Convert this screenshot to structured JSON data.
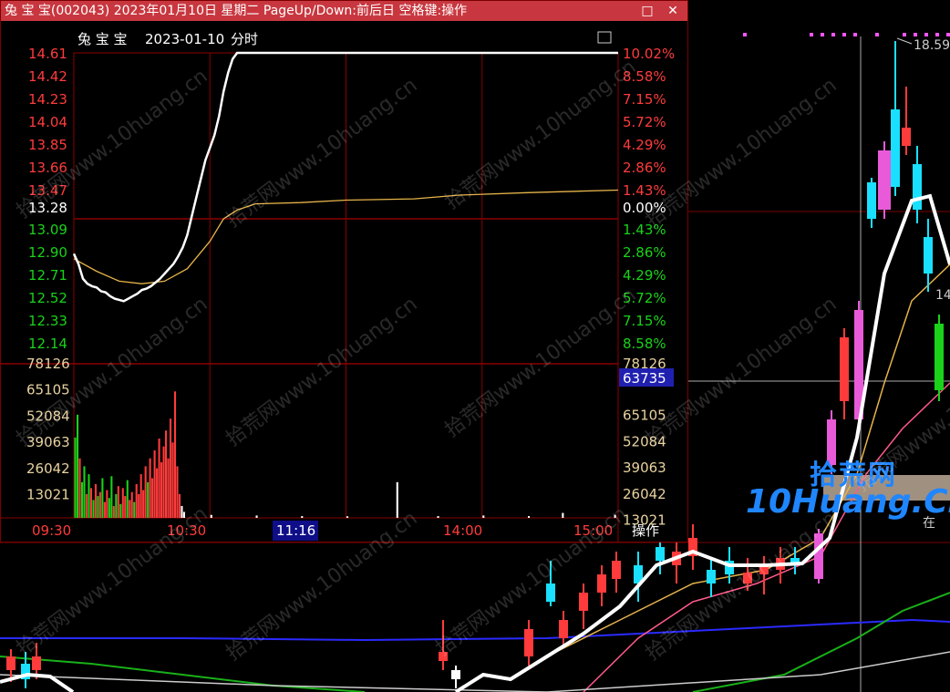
{
  "window": {
    "title": "兔 宝 宝(002043) 2023年01月10日 星期二 PageUp/Down:前后日 空格键:操作",
    "restore_icon": "restore-icon",
    "close_icon": "close-icon"
  },
  "header": {
    "stock_name": "兔 宝 宝",
    "date": "2023-01-10",
    "mode": "分时",
    "corner_icon": "expand-icon"
  },
  "colors": {
    "up": "#ff3b3b",
    "down": "#19d219",
    "neutral": "#ffffff",
    "price_line": "#ffffff",
    "avg_line": "#e6b34a",
    "grid": "#8a0000",
    "cursor_box": "#1010a0",
    "cursor_label": "#2020b0",
    "volume_axis": "#e8d2a0"
  },
  "chart_data": {
    "type": "line",
    "prev_close": 13.28,
    "price_axis": {
      "left_up": [
        "14.61",
        "14.42",
        "14.23",
        "14.04",
        "13.85",
        "13.66",
        "13.47"
      ],
      "left_center": "13.28",
      "left_down": [
        "13.09",
        "12.90",
        "12.71",
        "12.52",
        "12.33",
        "12.14"
      ],
      "right_up": [
        "10.02%",
        "8.58%",
        "7.15%",
        "5.72%",
        "4.29%",
        "2.86%",
        "1.43%"
      ],
      "right_center": "0.00%",
      "right_down": [
        "1.43%",
        "2.86%",
        "4.29%",
        "5.72%",
        "7.15%",
        "8.58%"
      ],
      "ylim": [
        12.14,
        14.61
      ]
    },
    "volume_axis": {
      "labels": [
        "78126",
        "65105",
        "52084",
        "39063",
        "26042",
        "13021"
      ],
      "ylim": [
        0,
        78126
      ],
      "cursor_value": "63735"
    },
    "time_axis": {
      "labels": [
        "09:30",
        "10:30",
        "11:16",
        "14:00",
        "15:00"
      ],
      "cursor_time": "11:16",
      "button_label": "操作"
    },
    "price_series": {
      "name": "",
      "points": [
        [
          0,
          13.0
        ],
        [
          2,
          12.92
        ],
        [
          4,
          12.8
        ],
        [
          6,
          12.76
        ],
        [
          8,
          12.74
        ],
        [
          10,
          12.73
        ],
        [
          12,
          12.7
        ],
        [
          14,
          12.69
        ],
        [
          16,
          12.66
        ],
        [
          18,
          12.64
        ],
        [
          20,
          12.63
        ],
        [
          22,
          12.62
        ],
        [
          24,
          12.64
        ],
        [
          26,
          12.66
        ],
        [
          28,
          12.68
        ],
        [
          30,
          12.71
        ],
        [
          32,
          12.72
        ],
        [
          34,
          12.74
        ],
        [
          36,
          12.77
        ],
        [
          38,
          12.8
        ],
        [
          40,
          12.84
        ],
        [
          42,
          12.88
        ],
        [
          44,
          12.92
        ],
        [
          46,
          12.98
        ],
        [
          48,
          13.05
        ],
        [
          50,
          13.15
        ],
        [
          52,
          13.3
        ],
        [
          54,
          13.45
        ],
        [
          56,
          13.6
        ],
        [
          58,
          13.75
        ],
        [
          60,
          13.85
        ],
        [
          62,
          13.95
        ],
        [
          64,
          14.1
        ],
        [
          66,
          14.3
        ],
        [
          68,
          14.45
        ],
        [
          70,
          14.56
        ],
        [
          72,
          14.61
        ],
        [
          240,
          14.61
        ]
      ]
    },
    "avg_series": {
      "name": "",
      "points": [
        [
          0,
          12.96
        ],
        [
          10,
          12.86
        ],
        [
          20,
          12.78
        ],
        [
          30,
          12.76
        ],
        [
          40,
          12.78
        ],
        [
          50,
          12.88
        ],
        [
          60,
          13.1
        ],
        [
          66,
          13.28
        ],
        [
          72,
          13.35
        ],
        [
          80,
          13.4
        ],
        [
          100,
          13.41
        ],
        [
          120,
          13.43
        ],
        [
          150,
          13.44
        ],
        [
          170,
          13.47
        ],
        [
          200,
          13.49
        ],
        [
          240,
          13.51
        ]
      ]
    },
    "volume_bars": [
      [
        0,
        40500,
        "down"
      ],
      [
        1,
        52000,
        "down"
      ],
      [
        2,
        30000,
        "up"
      ],
      [
        3,
        18000,
        "down"
      ],
      [
        4,
        26000,
        "down"
      ],
      [
        5,
        12000,
        "up"
      ],
      [
        6,
        22000,
        "down"
      ],
      [
        7,
        15000,
        "up"
      ],
      [
        8,
        9000,
        "down"
      ],
      [
        9,
        17000,
        "up"
      ],
      [
        10,
        11000,
        "down"
      ],
      [
        11,
        13000,
        "up"
      ],
      [
        12,
        20000,
        "down"
      ],
      [
        13,
        8000,
        "up"
      ],
      [
        14,
        14000,
        "up"
      ],
      [
        15,
        10000,
        "down"
      ],
      [
        16,
        21000,
        "down"
      ],
      [
        17,
        6000,
        "up"
      ],
      [
        18,
        12000,
        "down"
      ],
      [
        19,
        16000,
        "up"
      ],
      [
        20,
        7000,
        "down"
      ],
      [
        21,
        15000,
        "up"
      ],
      [
        22,
        11000,
        "up"
      ],
      [
        23,
        19000,
        "down"
      ],
      [
        24,
        9000,
        "up"
      ],
      [
        25,
        13000,
        "up"
      ],
      [
        26,
        8000,
        "down"
      ],
      [
        27,
        17000,
        "up"
      ],
      [
        28,
        12000,
        "up"
      ],
      [
        29,
        22000,
        "up"
      ],
      [
        30,
        14000,
        "up"
      ],
      [
        31,
        26000,
        "up"
      ],
      [
        32,
        18000,
        "down"
      ],
      [
        33,
        30000,
        "up"
      ],
      [
        34,
        20000,
        "up"
      ],
      [
        35,
        34000,
        "up"
      ],
      [
        36,
        25000,
        "up"
      ],
      [
        37,
        40000,
        "up"
      ],
      [
        38,
        28000,
        "up"
      ],
      [
        39,
        36000,
        "up"
      ],
      [
        40,
        44000,
        "up"
      ],
      [
        41,
        30000,
        "up"
      ],
      [
        42,
        50000,
        "up"
      ],
      [
        43,
        38000,
        "up"
      ],
      [
        44,
        63735,
        "up"
      ],
      [
        45,
        26000,
        "up"
      ],
      [
        46,
        12000,
        "up"
      ],
      [
        47,
        6000,
        "neutral"
      ],
      [
        48,
        3000,
        "neutral"
      ],
      [
        60,
        1500,
        "neutral"
      ],
      [
        80,
        1200,
        "neutral"
      ],
      [
        100,
        900,
        "neutral"
      ],
      [
        120,
        800,
        "neutral"
      ],
      [
        142,
        18000,
        "neutral"
      ],
      [
        160,
        900,
        "neutral"
      ],
      [
        180,
        1200,
        "neutral"
      ],
      [
        200,
        900,
        "neutral"
      ],
      [
        215,
        2500,
        "neutral"
      ],
      [
        238,
        1500,
        "neutral"
      ]
    ]
  },
  "background_chart": {
    "price_label": "18.59",
    "partial_label": "14",
    "right_label": "在",
    "candles_note": "",
    "logo_cn": "拾荒网",
    "logo_en": "Huang.CN",
    "logo_num": "10"
  },
  "watermark": {
    "text": "拾荒网www.10huang.cn"
  }
}
